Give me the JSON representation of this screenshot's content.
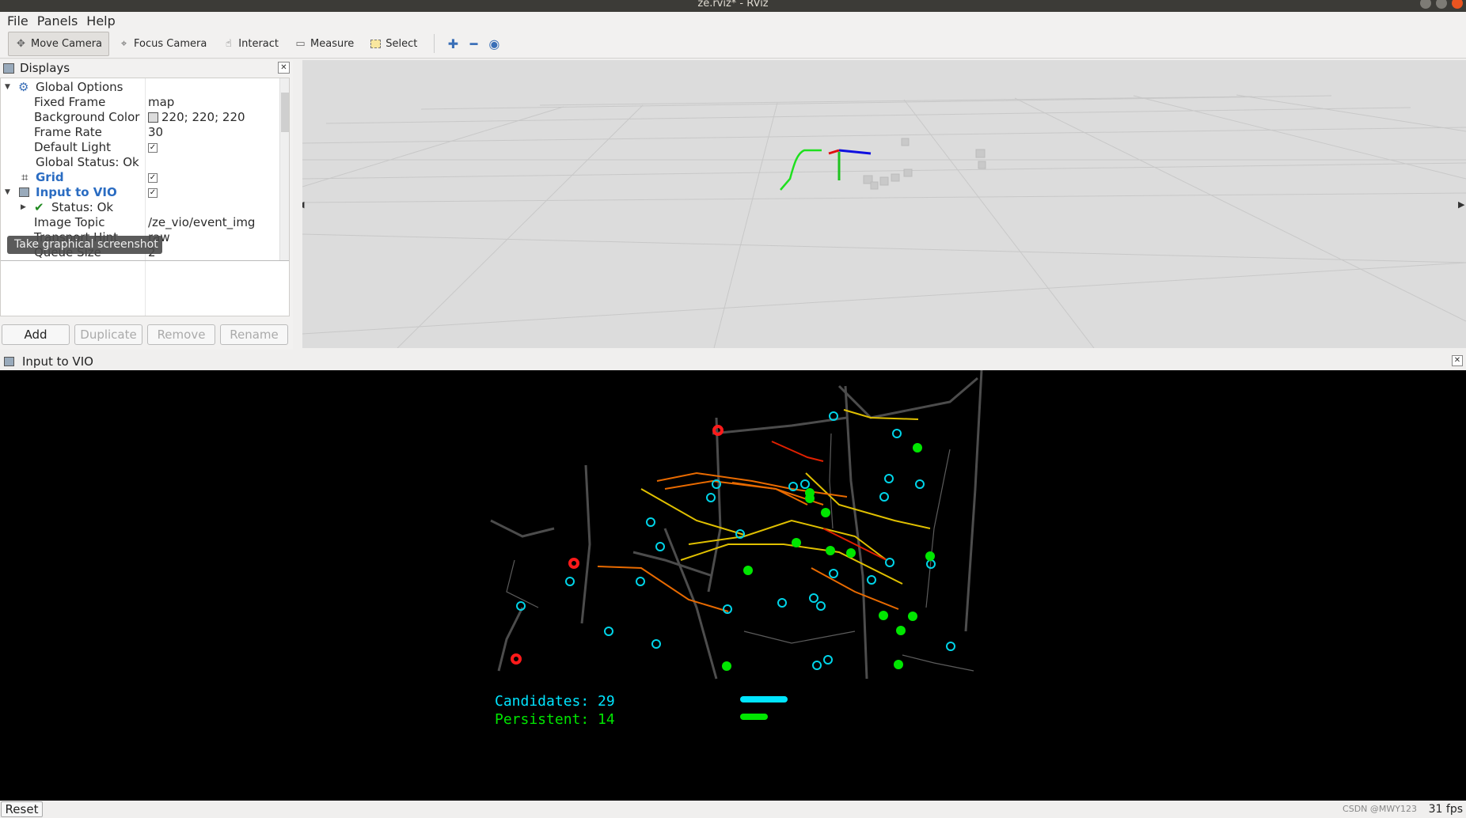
{
  "window": {
    "title": "ze.rviz* - RViz"
  },
  "menu": [
    "File",
    "Panels",
    "Help"
  ],
  "toolbar": {
    "move_camera": "Move Camera",
    "focus_camera": "Focus Camera",
    "interact": "Interact",
    "measure": "Measure",
    "select": "Select"
  },
  "displays": {
    "title": "Displays",
    "rows": {
      "global_options": "Global Options",
      "fixed_frame": {
        "k": "Fixed Frame",
        "v": "map"
      },
      "background_color": {
        "k": "Background Color",
        "v": "220; 220; 220"
      },
      "frame_rate": {
        "k": "Frame Rate",
        "v": "30"
      },
      "default_light": {
        "k": "Default Light",
        "v": "✓"
      },
      "global_status": "Global Status: Ok",
      "grid": "Grid",
      "input_to_vio": "Input to VIO",
      "status_ok": "Status: Ok",
      "image_topic": {
        "k": "Image Topic",
        "v": "/ze_vio/event_img"
      },
      "transport_hint": {
        "k": "Transport Hint",
        "v": "raw"
      },
      "queue_size": {
        "k": "Queue Size",
        "v": "2"
      }
    },
    "tooltip": "Take graphical screenshot",
    "buttons": {
      "add": "Add",
      "duplicate": "Duplicate",
      "remove": "Remove",
      "rename": "Rename"
    }
  },
  "image_panel": {
    "title": "Input to VIO",
    "candidates_label": "Candidates: 29",
    "persistent_label": "Persistent: 14"
  },
  "status": {
    "reset": "Reset",
    "fps": "31 fps",
    "watermark": "CSDN @MWY123"
  },
  "colors": {
    "background3d": "#dcdcdc",
    "candidate": "#00e5ff",
    "persistent": "#00e600",
    "lost": "#ff1a1a"
  }
}
